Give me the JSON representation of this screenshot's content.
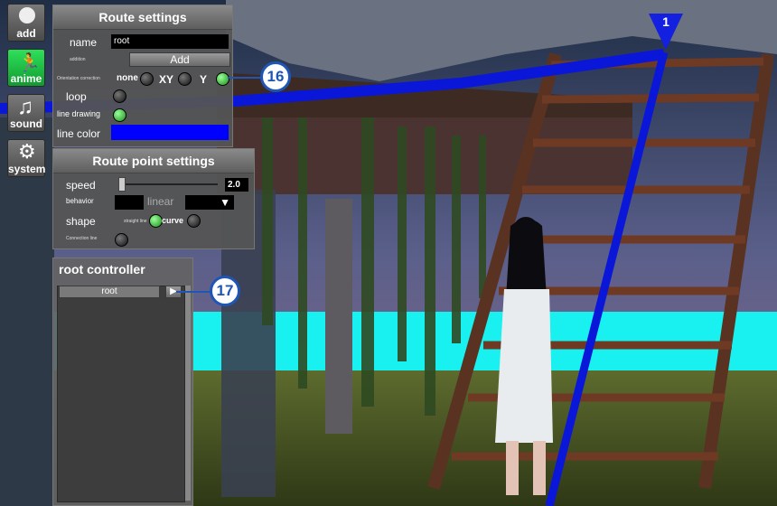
{
  "toolbar": [
    {
      "label": "add",
      "icon": "character-icon"
    },
    {
      "label": "anime",
      "icon": "running-figure-icon"
    },
    {
      "label": "sound",
      "icon": "music-note-icon"
    },
    {
      "label": "system",
      "icon": "gear-icon"
    }
  ],
  "route_settings": {
    "title": "Route settings",
    "name_label": "name",
    "name_value": "root",
    "addition_label": "addition",
    "add_button": "Add",
    "orientation_label": "Orientation correction",
    "opt_none": "none",
    "opt_xy": "XY",
    "opt_y": "Y",
    "loop_label": "loop",
    "line_drawing_label": "line drawing",
    "line_color_label": "line color",
    "line_color_value": "#0000ff"
  },
  "point_settings": {
    "title": "Route point settings",
    "speed_label": "speed",
    "speed_value": "2.0",
    "behavior_label": "behavior",
    "behavior_value": "linear",
    "shape_label": "shape",
    "straight_line_label": "straight line",
    "curve_label": "curve",
    "connection_label": "Connection line"
  },
  "root_controller": {
    "title": "root controller",
    "item": "root"
  },
  "scene": {
    "route_point_label": "1"
  },
  "callouts": {
    "c16": "16",
    "c17": "17"
  },
  "colors": {
    "route_line": "#0a17d8",
    "cyan_background": "#19f0f0",
    "panel": "#555555",
    "active_green": "#1fcf3f"
  }
}
